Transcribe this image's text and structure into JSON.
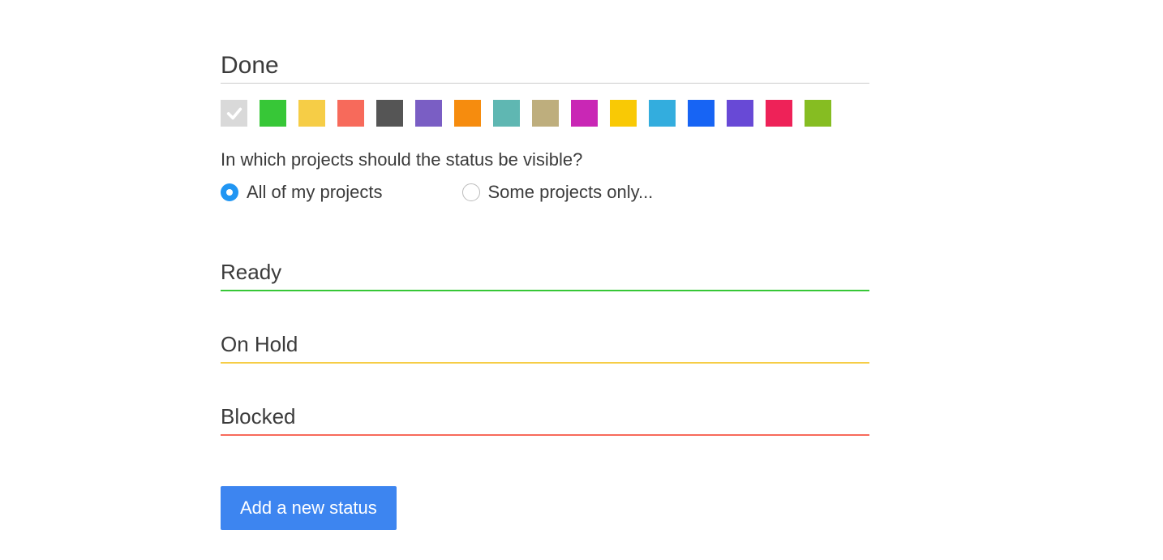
{
  "editing_status": {
    "name": "Done"
  },
  "colors": [
    {
      "name": "none",
      "hex": "#d9d9d9",
      "selected": true
    },
    {
      "name": "green",
      "hex": "#37c737",
      "selected": false
    },
    {
      "name": "yellow",
      "hex": "#f6cd46",
      "selected": false
    },
    {
      "name": "coral",
      "hex": "#f76a5b",
      "selected": false
    },
    {
      "name": "dark-gray",
      "hex": "#555555",
      "selected": false
    },
    {
      "name": "purple",
      "hex": "#7a5ec4",
      "selected": false
    },
    {
      "name": "orange",
      "hex": "#f68c0e",
      "selected": false
    },
    {
      "name": "teal",
      "hex": "#5fb7b2",
      "selected": false
    },
    {
      "name": "tan",
      "hex": "#beae7d",
      "selected": false
    },
    {
      "name": "magenta",
      "hex": "#c927b5",
      "selected": false
    },
    {
      "name": "gold",
      "hex": "#f9c905",
      "selected": false
    },
    {
      "name": "sky",
      "hex": "#33adde",
      "selected": false
    },
    {
      "name": "blue",
      "hex": "#1764f4",
      "selected": false
    },
    {
      "name": "violet",
      "hex": "#6849d6",
      "selected": false
    },
    {
      "name": "pink-red",
      "hex": "#ee2258",
      "selected": false
    },
    {
      "name": "lime",
      "hex": "#86bd22",
      "selected": false
    }
  ],
  "visibility": {
    "question": "In which projects should the status be visible?",
    "options": {
      "all": "All of my projects",
      "some": "Some projects only..."
    },
    "selected": "all"
  },
  "statuses": [
    {
      "label": "Ready",
      "underline": "#37c737"
    },
    {
      "label": "On Hold",
      "underline": "#f6cd46"
    },
    {
      "label": "Blocked",
      "underline": "#f76a5b"
    }
  ],
  "add_button": "Add a new status"
}
